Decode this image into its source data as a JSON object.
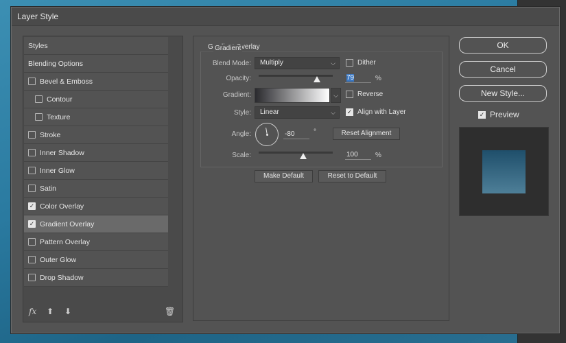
{
  "window": {
    "title": "Layer Style"
  },
  "background_panel": {
    "close_glyph": "✕"
  },
  "styles_list": [
    {
      "label": "Styles",
      "checkbox": false,
      "checked": false,
      "indent": false,
      "plus": false
    },
    {
      "label": "Blending Options",
      "checkbox": false,
      "checked": false,
      "indent": false,
      "plus": false
    },
    {
      "label": "Bevel & Emboss",
      "checkbox": true,
      "checked": false,
      "indent": false,
      "plus": false
    },
    {
      "label": "Contour",
      "checkbox": true,
      "checked": false,
      "indent": true,
      "plus": false
    },
    {
      "label": "Texture",
      "checkbox": true,
      "checked": false,
      "indent": true,
      "plus": false
    },
    {
      "label": "Stroke",
      "checkbox": true,
      "checked": false,
      "indent": false,
      "plus": true
    },
    {
      "label": "Inner Shadow",
      "checkbox": true,
      "checked": false,
      "indent": false,
      "plus": true
    },
    {
      "label": "Inner Glow",
      "checkbox": true,
      "checked": false,
      "indent": false,
      "plus": false
    },
    {
      "label": "Satin",
      "checkbox": true,
      "checked": false,
      "indent": false,
      "plus": false
    },
    {
      "label": "Color Overlay",
      "checkbox": true,
      "checked": true,
      "indent": false,
      "plus": true
    },
    {
      "label": "Gradient Overlay",
      "checkbox": true,
      "checked": true,
      "indent": false,
      "plus": true,
      "selected": true
    },
    {
      "label": "Pattern Overlay",
      "checkbox": true,
      "checked": false,
      "indent": false,
      "plus": false
    },
    {
      "label": "Outer Glow",
      "checkbox": true,
      "checked": false,
      "indent": false,
      "plus": false
    },
    {
      "label": "Drop Shadow",
      "checkbox": true,
      "checked": false,
      "indent": false,
      "plus": true
    }
  ],
  "bottom_icons": {
    "fx": "fx",
    "up": "⬆",
    "down": "⬇",
    "trash": "🗑"
  },
  "gradient_overlay": {
    "section_title": "Gradient Overlay",
    "group_title": "Gradient",
    "blend_mode_label": "Blend Mode:",
    "blend_mode_value": "Multiply",
    "dither_label": "Dither",
    "dither_checked": false,
    "opacity_label": "Opacity:",
    "opacity_value": "79",
    "opacity_unit": "%",
    "opacity_fraction": 0.79,
    "gradient_label": "Gradient:",
    "reverse_label": "Reverse",
    "reverse_checked": false,
    "style_label": "Style:",
    "style_value": "Linear",
    "align_label": "Align with Layer",
    "align_checked": true,
    "angle_label": "Angle:",
    "angle_value": "-80",
    "angle_unit": "°",
    "reset_alignment_label": "Reset Alignment",
    "scale_label": "Scale:",
    "scale_value": "100",
    "scale_unit": "%",
    "scale_fraction": 0.6,
    "make_default_label": "Make Default",
    "reset_default_label": "Reset to Default"
  },
  "buttons": {
    "ok": "OK",
    "cancel": "Cancel",
    "new_style": "New Style..."
  },
  "preview": {
    "label": "Preview",
    "checked": true
  },
  "colors": {
    "accent": "#3a77c2",
    "dialog_bg": "#535353"
  }
}
